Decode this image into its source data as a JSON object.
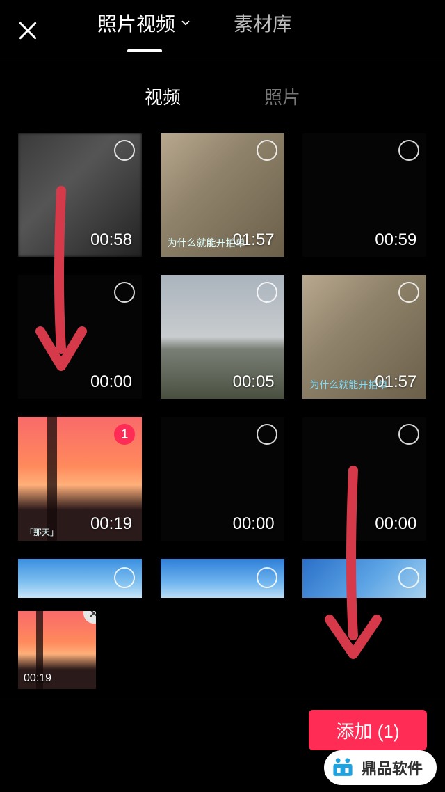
{
  "header": {
    "tab_primary": "照片视频",
    "tab_secondary": "素材库"
  },
  "subtabs": {
    "video": "视频",
    "photo": "照片"
  },
  "videos": [
    {
      "duration": "00:58",
      "selected": false,
      "caption": ""
    },
    {
      "duration": "01:57",
      "selected": false,
      "caption": "为什么就能开拍单"
    },
    {
      "duration": "00:59",
      "selected": false,
      "caption": ""
    },
    {
      "duration": "00:00",
      "selected": false,
      "caption": ""
    },
    {
      "duration": "00:05",
      "selected": false,
      "caption": ""
    },
    {
      "duration": "01:57",
      "selected": false,
      "caption": "为什么就能开拍单"
    },
    {
      "duration": "00:19",
      "selected": true,
      "selected_index": "1",
      "caption": "「那天」"
    },
    {
      "duration": "00:00",
      "selected": false,
      "caption": ""
    },
    {
      "duration": "00:00",
      "selected": false,
      "caption": ""
    }
  ],
  "selected_strip": [
    {
      "duration": "00:19"
    }
  ],
  "add_button": {
    "label": "添加 (1)"
  },
  "watermark": {
    "text": "鼎品软件"
  }
}
